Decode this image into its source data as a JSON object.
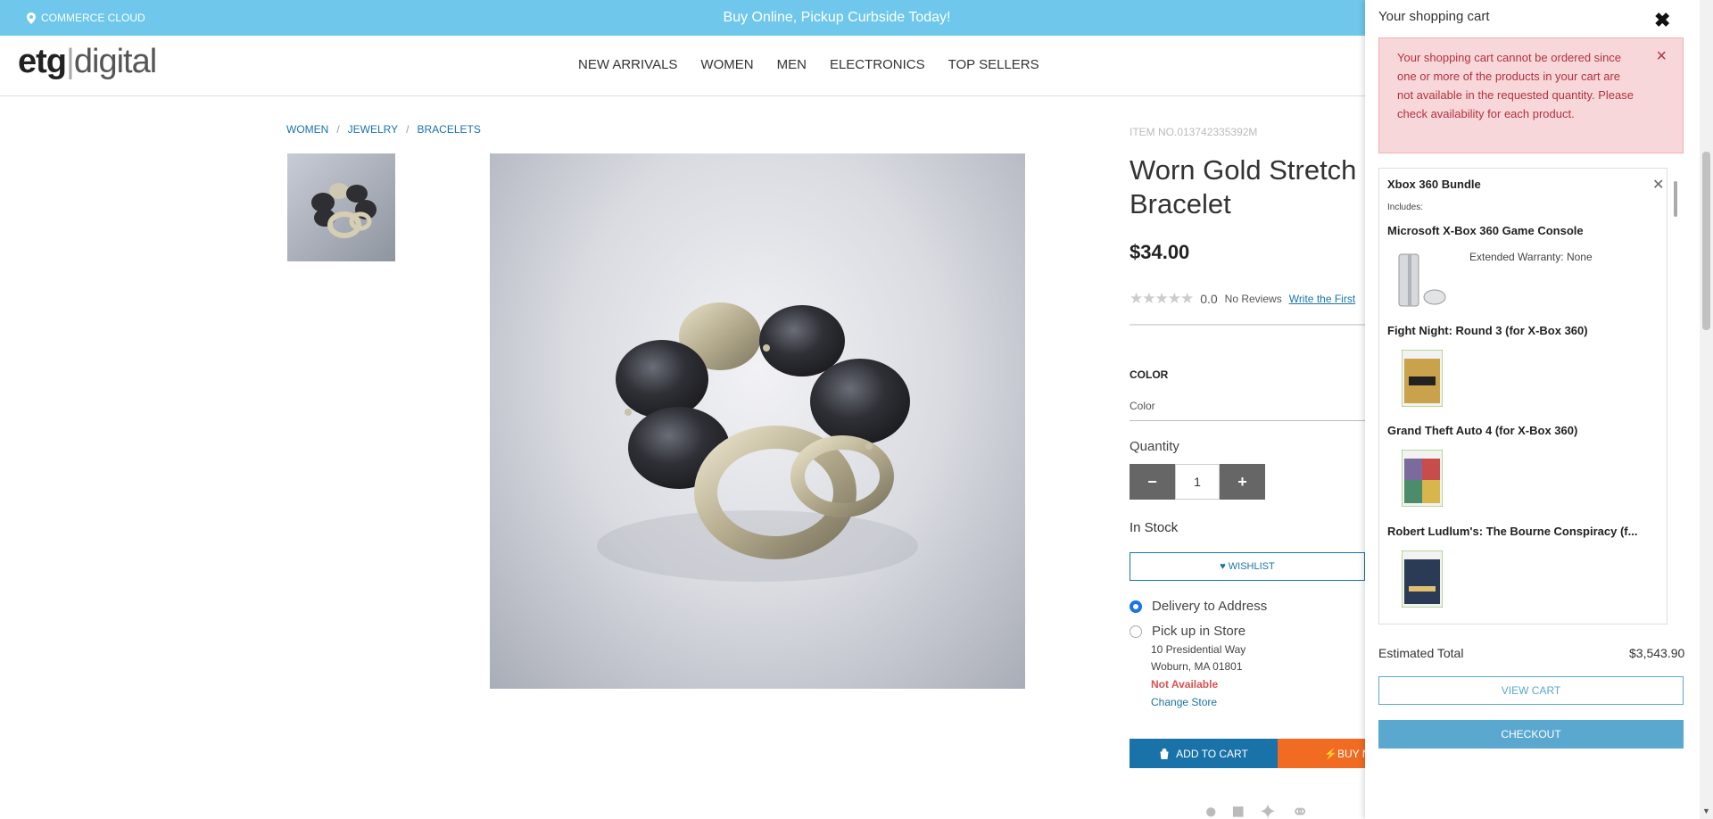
{
  "topbar": {
    "location_label": "COMMERCE CLOUD",
    "promo": "Buy Online, Pickup Curbside Today!"
  },
  "logo": {
    "part1": "etg",
    "part2": "digital"
  },
  "nav": {
    "items": [
      "NEW ARRIVALS",
      "WOMEN",
      "MEN",
      "ELECTRONICS",
      "TOP SELLERS"
    ]
  },
  "breadcrumb": [
    "WOMEN",
    "JEWELRY",
    "BRACELETS"
  ],
  "product": {
    "item_no": "ITEM NO.013742335392M",
    "title": "Worn Gold Stretch Bracelet",
    "price": "$34.00",
    "rating": "0.0",
    "reviews": "No Reviews",
    "write_review": "Write the First",
    "color_label": "COLOR",
    "color_select": "Color",
    "quantity_label": "Quantity",
    "quantity": "1",
    "stock": "In Stock",
    "wishlist": "WISHLIST",
    "delivery_option": "Delivery to Address",
    "pickup_option": "Pick up in Store",
    "store_address1": "10 Presidential Way",
    "store_address2": "Woburn, MA 01801",
    "store_status": "Not Available",
    "change_store": "Change Store",
    "add_to_cart": "ADD TO CART",
    "buy_now": "BUY NOW"
  },
  "cart": {
    "title": "Your shopping cart",
    "alert": "Your shopping cart cannot be ordered since one or more of the products in your cart are not available in the requested quantity. Please check availability for each product.",
    "bundle_name": "Xbox 360 Bundle",
    "includes_label": "Includes:",
    "items": [
      {
        "name": "Microsoft X-Box 360 Game Console",
        "warranty": "Extended Warranty: None"
      },
      {
        "name": "Fight Night: Round 3 (for X-Box 360)"
      },
      {
        "name": "Grand Theft Auto 4 (for X-Box 360)"
      },
      {
        "name": "Robert Ludlum's: The Bourne Conspiracy (f..."
      }
    ],
    "estimated_total_label": "Estimated Total",
    "estimated_total": "$3,543.90",
    "view_cart": "VIEW CART",
    "checkout": "CHECKOUT"
  },
  "colors": {
    "topbar": "#6fc8eb",
    "primary": "#1a73a8",
    "buy_now": "#f26b22",
    "alert_bg": "#f8d7da"
  }
}
